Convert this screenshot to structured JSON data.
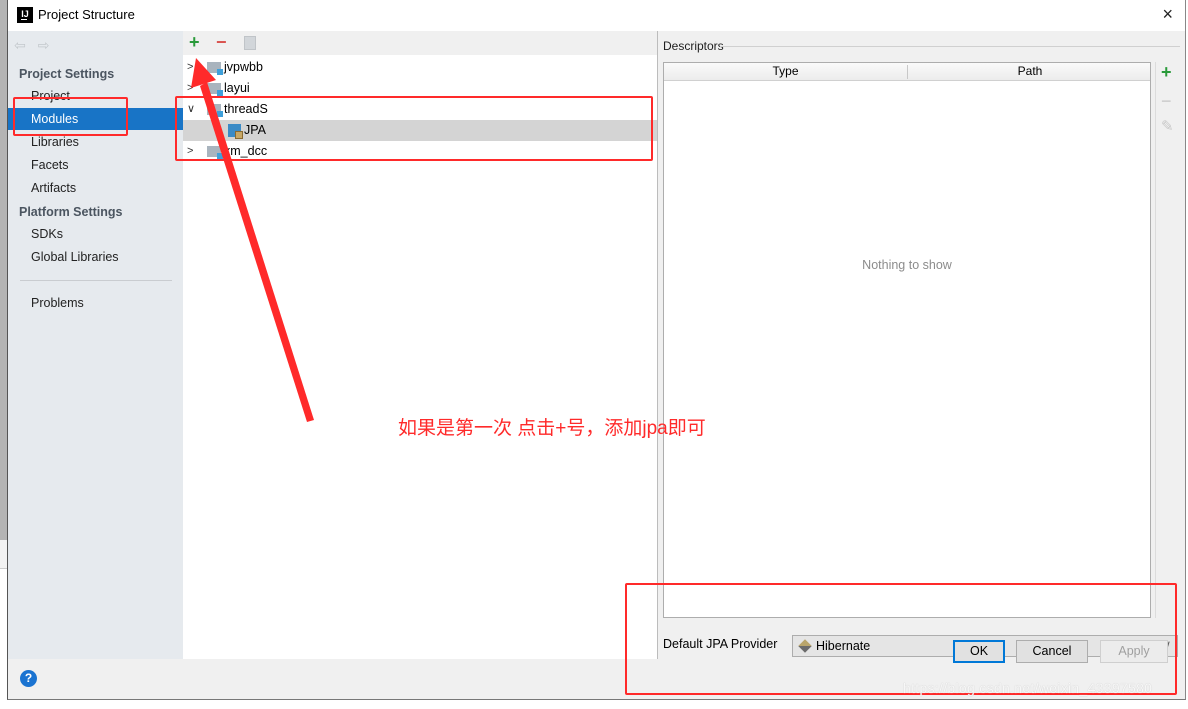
{
  "window": {
    "title": "Project Structure",
    "app_icon": "IJ",
    "close_icon": "×"
  },
  "sidebar": {
    "back_icon": "⇦",
    "forward_icon": "⇨",
    "groups": [
      {
        "title": "Project Settings",
        "items": [
          "Project",
          "Modules",
          "Libraries",
          "Facets",
          "Artifacts"
        ]
      },
      {
        "title": "Platform Settings",
        "items": [
          "SDKs",
          "Global Libraries"
        ]
      }
    ],
    "problems": "Problems",
    "selected": "Modules"
  },
  "tree": {
    "toolbar": {
      "add": "+",
      "remove": "−",
      "copy": "copy-icon"
    },
    "rows": [
      {
        "label": "jvpwbb",
        "expanded": false,
        "icon": "module-folder-icon"
      },
      {
        "label": "layui",
        "expanded": false,
        "icon": "module-folder-icon"
      },
      {
        "label": "threadS",
        "expanded": true,
        "icon": "module-folder-icon"
      },
      {
        "label": "JPA",
        "icon": "jpa-facet-icon",
        "selected": true
      },
      {
        "label": "xm_dcc",
        "expanded": false,
        "icon": "module-folder-icon"
      }
    ]
  },
  "descriptors": {
    "title": "Descriptors",
    "columns": [
      "Type",
      "Path"
    ],
    "empty_text": "Nothing to show",
    "tools": {
      "add": "+",
      "remove": "−",
      "edit": "✎"
    }
  },
  "provider": {
    "label": "Default JPA Provider",
    "value": "Hibernate",
    "arrow": "∨"
  },
  "footer": {
    "ok": "OK",
    "cancel": "Cancel",
    "apply": "Apply",
    "help": "?"
  },
  "annotation": {
    "text": "如果是第一次 点击+号，添加jpa即可",
    "color": "#ff2a2a"
  },
  "watermark": "https://blog.csdn.net/weixin_43397580"
}
